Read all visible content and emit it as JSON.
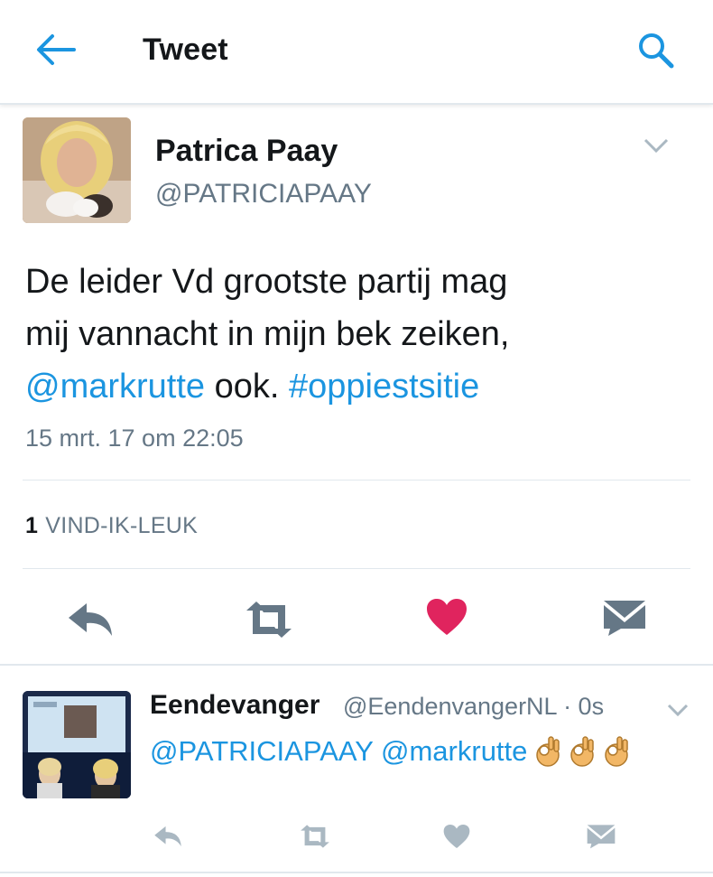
{
  "header": {
    "title": "Tweet"
  },
  "tweet": {
    "author_name": "Patrica Paay",
    "author_handle": "@PATRICIAPAAY",
    "text_line1": "De leider Vd grootste partij mag",
    "text_line2": "mij vannacht in mijn bek zeiken,",
    "mention": "@markrutte",
    "text_mid": " ook. ",
    "hashtag": "#oppiestsitie",
    "timestamp": "15 mrt. 17 om 22:05",
    "like_count": "1",
    "like_label": "VIND-IK-LEUK"
  },
  "reply": {
    "author_name": "Eendevanger",
    "author_handle_time": "@EendenvangerNL · 0s",
    "mention1": "@PATRICIAPAAY",
    "mention2": "@markrutte"
  },
  "colors": {
    "link": "#1b95e0",
    "like": "#e0245e",
    "icon": "#657786",
    "muted": "#aab8c2"
  },
  "icons": [
    "back-arrow-icon",
    "search-icon",
    "chevron-down-icon",
    "reply-icon",
    "retweet-icon",
    "heart-icon",
    "message-icon",
    "ok-hand-emoji"
  ]
}
